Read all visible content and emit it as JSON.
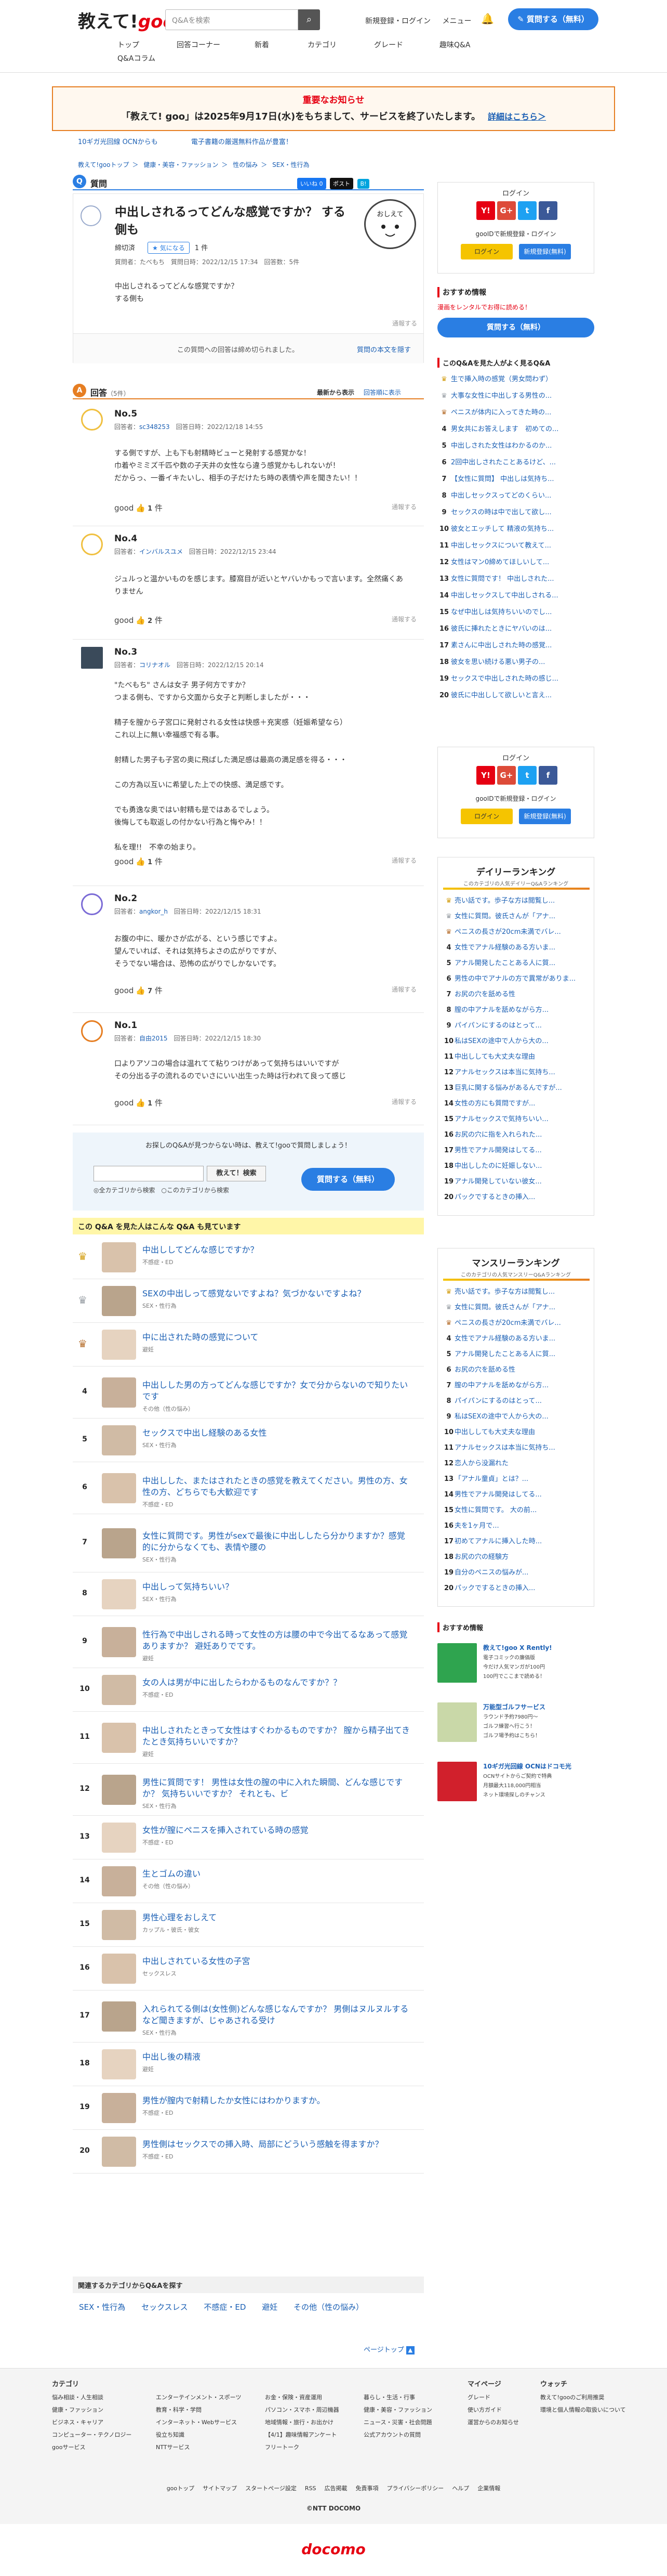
{
  "header": {
    "logo_text": "教えて!",
    "logo_goo": "goo",
    "search_placeholder": "Q&Aを検索",
    "links": [
      "新規登録・ログイン",
      "メニュー"
    ],
    "ask_button": "質問する（無料）",
    "nav": [
      "トップ",
      "回答コーナー",
      "新着",
      "カテゴリ",
      "グレード",
      "趣味Q&A",
      "Q&Aコラム"
    ]
  },
  "notice": {
    "title": "重要なお知らせ",
    "text": "「教えて! goo」は2025年9月17日(水)をもちまして、サービスを終了いたします。",
    "link": "詳細はこちら＞"
  },
  "ads": [
    "10ギガ光回線 OCNからも",
    "電子書籍の厳選無料作品が豊富！"
  ],
  "breadcrumb": [
    "教えて!gooトップ",
    "＞",
    "健康・美容・ファッション",
    "＞",
    "性の悩み",
    "＞",
    "SEX・性行為"
  ],
  "question": {
    "label": "質問",
    "share": [
      "いいね 0",
      "ポスト",
      "B!"
    ],
    "title": "中出しされるってどんな感覚ですか？ する側も",
    "status": "締切済",
    "tag": "気になる",
    "tag_count": "1 件",
    "meta": "質問者：たべもち　質問日時：2022/12/15 17:34　回答数：5件",
    "body": "中出しされるってどんな感覚ですか？\nする側も",
    "report": "通報する",
    "closed_text": "この質問への回答は締め切られました。",
    "closed_link": "質問の本文を隠す"
  },
  "answers_head": {
    "label": "回答",
    "count": "（5件）",
    "sort": [
      "最新から表示",
      "回答順に表示"
    ]
  },
  "answers": [
    {
      "no": "No.5",
      "meta_prefix": "回答者：",
      "user": "sc348253",
      "date": "回答日時：2022/12/18 14:55",
      "body": "する側ですが、上も下も射精時ビューと発射する感覚かな！\n巾着やミミズ千匹や数の子天井の女性なら違う感覚かもしれないが！\nだからっ、一番イキたいし、相手の子だけたち時の表情や声を聞きたい！！",
      "good_label": "good",
      "good_count": "1",
      "unit": "件",
      "report": "通報する"
    },
    {
      "no": "No.4",
      "meta_prefix": "回答者：",
      "user": "インバルスユメ",
      "date": "回答日時：2022/12/15 23:44",
      "body": "ジュルっと温かいものを感じます。膝窩目が近いとヤバいかもっで言います。全然痛くありません",
      "good_label": "good",
      "good_count": "2",
      "unit": "件",
      "report": "通報する"
    },
    {
      "no": "No.3",
      "meta_prefix": "回答者：",
      "user": "コリナオル",
      "date": "回答日時：2022/12/15 20:14",
      "body": "\"たべもち\" さんは女子 男子何方ですか？\nつまる側も、ですから文面から女子と判断しましたが・・・\n\n精子を膣から子宮口に発射される女性は快感＋充実感（妊娠希望なら）\nこれ以上に無い幸福感で有る事。\n\n射精した男子も子宮の奥に飛ばした満足感は最高の満足感を得る・・・\n\nこの方為以互いに希望した上での快感、満足感です。\n\nでも勇逸な奥ではい射精も是ではあるでしょう。\n後悔しても取返しの付かない行為と悔やみ！！\n\n私を理!!　不幸の始まり。",
      "good_label": "good",
      "good_count": "1",
      "unit": "件",
      "report": "通報する"
    },
    {
      "no": "No.2",
      "meta_prefix": "回答者：",
      "user": "angkor_h",
      "date": "回答日時：2022/12/15 18:31",
      "body": "お腹の中に、暖かさが広がる、という感じですよ。\n望んでいれば、それは気持ちよさの広がりですが、\nそうでない場合は、恐怖の広がりでしかないです。",
      "good_label": "good",
      "good_count": "7",
      "unit": "件",
      "report": "通報する"
    },
    {
      "no": "No.1",
      "meta_prefix": "回答者：",
      "user": "自由2015",
      "date": "回答日時：2022/12/15 18:30",
      "body": "口よりアソコの場合は温れてて粘りつけがあって気持ちはいいですが\nその分出る子の流れるのでいさにいい出生った時は行われて良って感じ",
      "good_label": "good",
      "good_count": "1",
      "unit": "件",
      "report": "通報する"
    }
  ],
  "answering": {
    "text": "お探しのQ&Aが見つからない時は、教えて!gooで質問しましょう！",
    "search_btn": "教えて！検索",
    "radio": "◎全カテゴリから検索　○このカテゴリから検索",
    "ask": "質問する（無料）"
  },
  "related_head": "この Q&A を見た人はこんな Q&A も見ています",
  "related": [
    {
      "rank": "1",
      "title": "中出ししてどんな感じですか？",
      "cat": "不感症・ED"
    },
    {
      "rank": "2",
      "title": "SEXの中出しって感覚ないですよね？気づかないですよね？",
      "cat": "SEX・性行為"
    },
    {
      "rank": "3",
      "title": "中に出された時の感覚について",
      "cat": "避妊"
    },
    {
      "rank": "4",
      "title": "中出しした男の方ってどんな感じですか？女で分からないので知りたいです",
      "cat": "その他（性の悩み）"
    },
    {
      "rank": "5",
      "title": "セックスで中出し経験のある女性",
      "cat": "SEX・性行為"
    },
    {
      "rank": "6",
      "title": "中出しした、またはされたときの感覚を教えてください。男性の方、女性の方、どちらでも大歓迎です",
      "cat": "不感症・ED"
    },
    {
      "rank": "7",
      "title": "女性に質問です。男性がsexで最後に中出ししたら分かりますか？感覚的に分からなくても、表情や腰の",
      "cat": "SEX・性行為"
    },
    {
      "rank": "8",
      "title": "中出しって気持ちいい？",
      "cat": "SEX・性行為"
    },
    {
      "rank": "9",
      "title": "性行為で中出しされる時って女性の方は腰の中で今出てるなあって感覚ありますか？ 避妊ありでです。",
      "cat": "避妊"
    },
    {
      "rank": "10",
      "title": "女の人は男が中に出したらわかるものなんですか？？",
      "cat": "不感症・ED"
    },
    {
      "rank": "11",
      "title": "中出しされたときって女性はすぐわかるものですか？ 膣から精子出てきたとき気持ちいいですか？",
      "cat": "避妊"
    },
    {
      "rank": "12",
      "title": "男性に質問です！ 男性は女性の膣の中に入れた瞬間、どんな感じですか？ 気持ちいいですか？ それとも、ビ",
      "cat": "SEX・性行為"
    },
    {
      "rank": "13",
      "title": "女性が膣にペニスを挿入されている時の感覚",
      "cat": "不感症・ED"
    },
    {
      "rank": "14",
      "title": "生とゴムの違い",
      "cat": "その他（性の悩み）"
    },
    {
      "rank": "15",
      "title": "男性心理をおしえて",
      "cat": "カップル・彼氏・彼女"
    },
    {
      "rank": "16",
      "title": "中出しされている女性の子宮",
      "cat": "セックスレス"
    },
    {
      "rank": "17",
      "title": "入れられてる側は(女性側)どんな感じなんですか？ 男側はヌルヌルするなど聞きますが、じゃあされる受け",
      "cat": "SEX・性行為"
    },
    {
      "rank": "18",
      "title": "中出し後の精液",
      "cat": "避妊"
    },
    {
      "rank": "19",
      "title": "男性が膣内で射精したか女性にはわかりますか。",
      "cat": "不感症・ED"
    },
    {
      "rank": "20",
      "title": "男性側はセックスでの挿入時、局部にどういう感触を得ますか？",
      "cat": "不感症・ED"
    }
  ],
  "related_cat_head": "関連するカテゴリからQ&Aを探す",
  "related_cats": [
    "SEX・性行為",
    "セックスレス",
    "不感症・ED",
    "避妊",
    "その他（性の悩み）"
  ],
  "pagetop": "ページトップ",
  "sidebar": {
    "login_title": "ログイン",
    "login_sub": "gooIDで新規登録・ログイン",
    "login_btn": "ログイン",
    "register_btn": "新規登録(無料)",
    "recommend_head": "おすすめ情報",
    "recommend_link": "漫画をレンタルでお得に読める！",
    "ask_btn": "質問する（無料）",
    "popular_head": "このQ&Aを見た人がよく見るQ&A",
    "popular": [
      "生で挿入時の感覚（男女問わず）",
      "大事な女性に中出しする男性の...",
      "ペニスが体内に入ってきた時の...",
      "男女共にお答えします　初めての...",
      "中出しされた女性はわかるのか...",
      "2回中出しされたことあるけど、...",
      "【女性に質問】 中出しは気持ち...",
      "中出しセックスってどのくらい...",
      "セックスの時は中で出して欲し...",
      "彼女とエッチして 精液の気持ち...",
      "中出しセックスについて教えて...",
      "女性はマン0締めてほしいして...",
      "女性に質問です！ 中出しされた...",
      "中出しセックスして中出しされる...",
      "なぜ中出しは気持ちいいのでし...",
      "彼氏に挿れたときにヤバいのは...",
      "素さんに中出しされた時の感覚...",
      "彼女を思い続ける悪い男子の...",
      "セックスで中出しされた時の感じ...",
      "彼氏に中出しして欲しいと言え..."
    ],
    "daily_title": "デイリーランキング",
    "daily_sub": "このカテゴリの人気デイリーQ&Aランキング",
    "daily": [
      "売い話です。歩子な方は閲覧し...",
      "女性に質問。彼氏さんが「アナ...",
      "ペニスの長さが20cm未満でバレ...",
      "女性でアナル経験のある方いま...",
      "アナル開発したことある人に質...",
      "男性の中でアナルの方で異常がありま...",
      "お尻の穴を舐める性",
      "膣の中アナルを舐めながら方...",
      "パイパンにするのはとって...",
      "私はSEXの途中で人から大の...",
      "中出ししても大丈夫な理由",
      "アナルセックスは本当に気持ち...",
      "巨乳に関する悩みがあるんですが...",
      "女性の方にも質問ですが...",
      "アナルセックスで気持ちいい...",
      "お尻の穴に指を入れられた...",
      "男性でアナル開発はしてる...",
      "中出ししたのに妊娠しない...",
      "アナル開発していない彼女...",
      "パックでするときの挿入..."
    ],
    "monthly_title": "マンスリーランキング",
    "monthly_sub": "このカテゴリの人気マンスリーQ&Aランキング",
    "monthly": [
      "売い話です。歩子な方は閲覧し...",
      "女性に質問。彼氏さんが「アナ...",
      "ペニスの長さが20cm未満でバレ...",
      "女性でアナル経験のある方いま...",
      "アナル開発したことある人に質...",
      "お尻の穴を舐める性",
      "膣の中アナルを舐めながら方...",
      "パイパンにするのはとって...",
      "私はSEXの途中で人から大の...",
      "中出ししても大丈夫な理由",
      "アナルセックスは本当に気持ち...",
      "恋人から没漏れた",
      "「アナル童貞」とは？...",
      "男性でアナル開発はしてる...",
      "女性に質問です。 大の前...",
      "夫を1ヶ月で...",
      "初めてアナルに挿入した時...",
      "お尻の穴の経験方",
      "自分のペニスの悩みが...",
      "パックでするときの挿入..."
    ],
    "promo_head": "おすすめ情報",
    "promo": [
      {
        "title": "教えて!goo X Rently!",
        "lines": [
          "電子コミックの廉価版",
          "今だけ人気マンガが100円",
          "100円でここまで読める！"
        ]
      },
      {
        "title": "万能型ゴルフサービス",
        "lines": [
          "ラウンド予約7980円〜",
          "ゴルフ練習へ行こう！",
          "ゴルフ場予約はこちら！"
        ]
      },
      {
        "title": "10ギガ光回線 OCNはドコモ光",
        "lines": [
          "OCNサイトからご契約で特典",
          "月額最大118,000円相当",
          "ネット環境探しのチャンス"
        ]
      }
    ]
  },
  "footer": {
    "cols": [
      {
        "h": "カテゴリ",
        "items": [
          "悩み相談・人生相談",
          "健康・ファッション",
          "ビジネス・キャリア",
          "コンピューター・テクノロジー",
          "gooサービス"
        ]
      },
      {
        "h": "",
        "items": [
          "エンターテインメント・スポーツ",
          "教育・科学・学問",
          "インターネット・Webサービス",
          "役立ち知識",
          "NTTサービス"
        ]
      },
      {
        "h": "",
        "items": [
          "お金・保険・資産運用",
          "パソコン・スマホ・周辺機器",
          "地域情報・旅行・お出かけ",
          "【4/1】趣味情報アンケート",
          "フリートーク"
        ]
      },
      {
        "h": "",
        "items": [
          "暮らし・生活・行事",
          "健康・美容・ファッション",
          "ニュース・災害・社会問題",
          "公式アカウントの質問"
        ]
      },
      {
        "h": "マイページ",
        "items": [
          "グレード",
          "使い方ガイド",
          "運営からのお知らせ"
        ]
      },
      {
        "h": "ウォッチ",
        "items": [
          "教えて!gooのご利用推奨",
          "環境と個人情報の取扱いについて"
        ]
      }
    ],
    "links": [
      "gooトップ",
      "サイトマップ",
      "スタートページ設定",
      "RSS",
      "広告掲載",
      "免責事項",
      "プライバシーポリシー",
      "ヘルプ",
      "企業情報"
    ],
    "copyright": "©NTT DOCOMO",
    "brand": "docomo"
  },
  "colors": {
    "brand_red": "#e60012",
    "accent_blue": "#2a7ee3",
    "answer_orange": "#e67e22"
  }
}
